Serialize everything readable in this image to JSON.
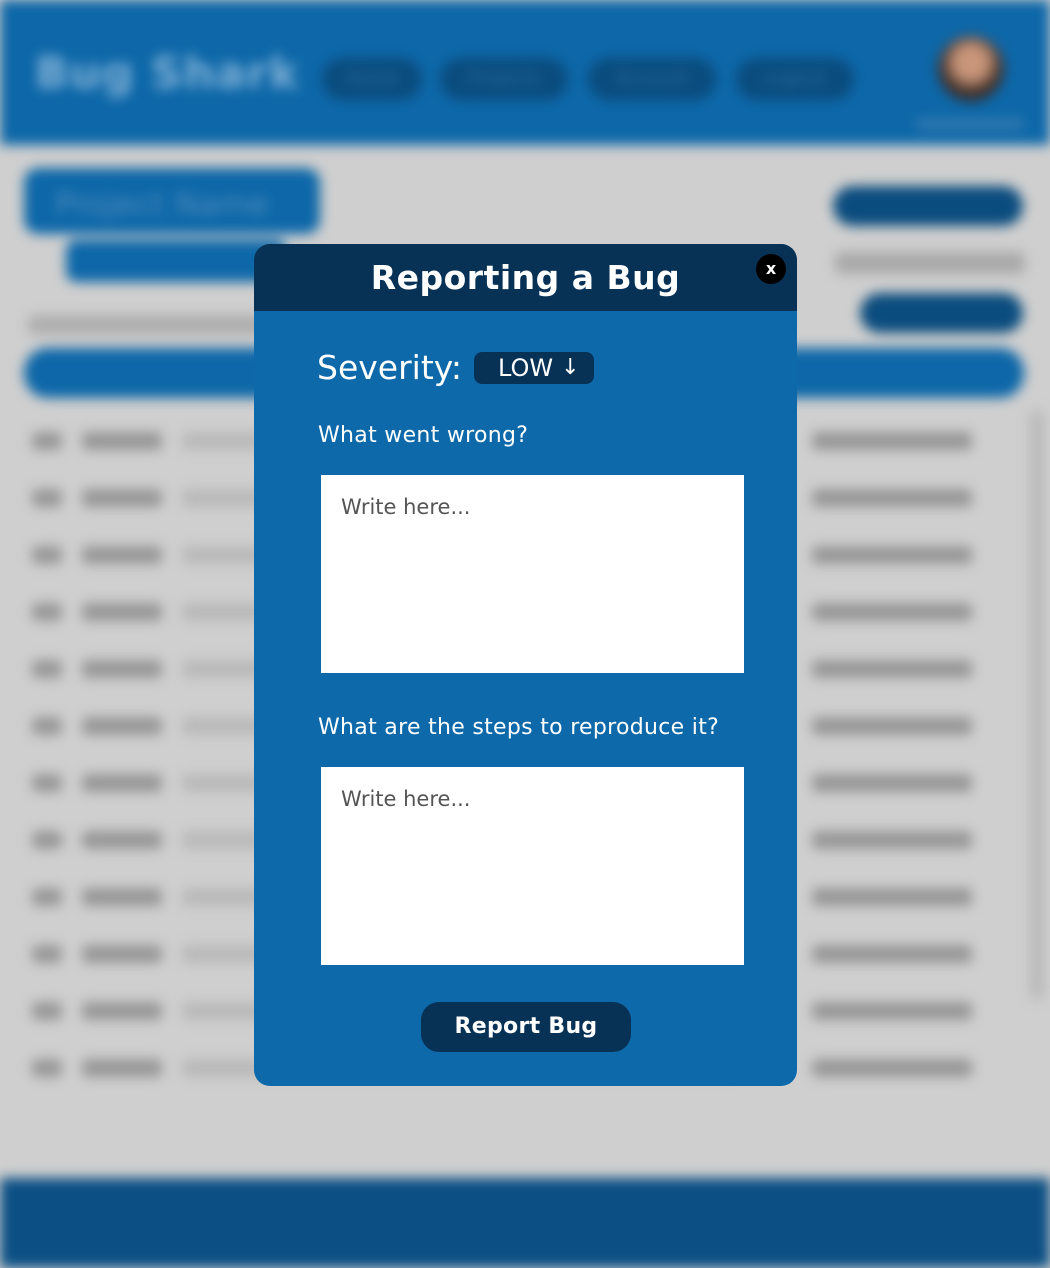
{
  "background": {
    "logo_text": "Bug Shark",
    "nav": [
      "Home",
      "Projects",
      "Account",
      "Logout"
    ],
    "project_name": "Project Name"
  },
  "modal": {
    "title": "Reporting a Bug",
    "close_label": "x",
    "severity_label": "Severity:",
    "severity_value": "LOW",
    "severity_arrow": "↓",
    "question_1": "What went wrong?",
    "question_1_placeholder": "Write here...",
    "question_2": "What are the steps to reproduce it?",
    "question_2_placeholder": "Write here...",
    "submit_label": "Report Bug"
  }
}
